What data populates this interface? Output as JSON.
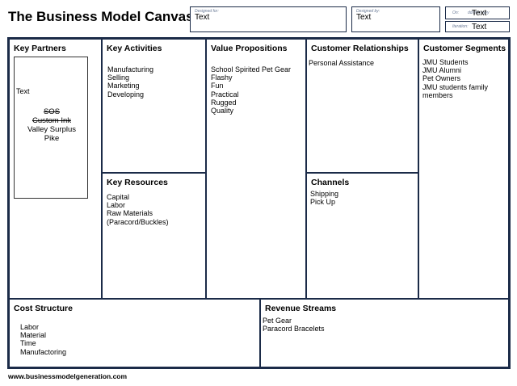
{
  "title": "The Business Model Canvas",
  "header": {
    "designed_for": {
      "label": "Designed for:",
      "value": "Text"
    },
    "designed_by": {
      "label": "Designed by:",
      "value": "Text"
    },
    "on": {
      "label": "On:",
      "hint": "dd/mm/yyyy",
      "value": "Text"
    },
    "iteration": {
      "label": "Iteration:",
      "value": "Text"
    }
  },
  "sections": {
    "key_partners": {
      "title": "Key Partners",
      "note_text": "Text",
      "items": [
        "SOS",
        "Custom Ink",
        "Valley Surplus",
        "Pike"
      ]
    },
    "key_activities": {
      "title": "Key Activities",
      "items": [
        "Manufacturing",
        "Selling",
        "Marketing",
        "Developing"
      ]
    },
    "value_propositions": {
      "title": "Value Propositions",
      "items": [
        "School Spirited Pet Gear",
        "Flashy",
        "Fun",
        "Practical",
        "Rugged",
        "Quality"
      ]
    },
    "customer_relationships": {
      "title": "Customer Relationships",
      "items": [
        "Personal Assistance"
      ]
    },
    "customer_segments": {
      "title": "Customer Segments",
      "items": [
        "JMU Students",
        "JMU Alumni",
        "Pet Owners",
        "JMU students family",
        "members"
      ]
    },
    "key_resources": {
      "title": "Key Resources",
      "items": [
        "Capital",
        "Labor",
        "Raw Materials",
        "(Paracord/Buckles)"
      ]
    },
    "channels": {
      "title": "Channels",
      "items": [
        "Shipping",
        "Pick Up"
      ]
    },
    "cost_structure": {
      "title": "Cost Structure",
      "items": [
        "Labor",
        "Material",
        "Time",
        "Manufactoring"
      ]
    },
    "revenue_streams": {
      "title": "Revenue Streams",
      "items": [
        "Pet Gear",
        "Paracord Bracelets"
      ]
    }
  },
  "footer": "www.businessmodelgeneration.com"
}
